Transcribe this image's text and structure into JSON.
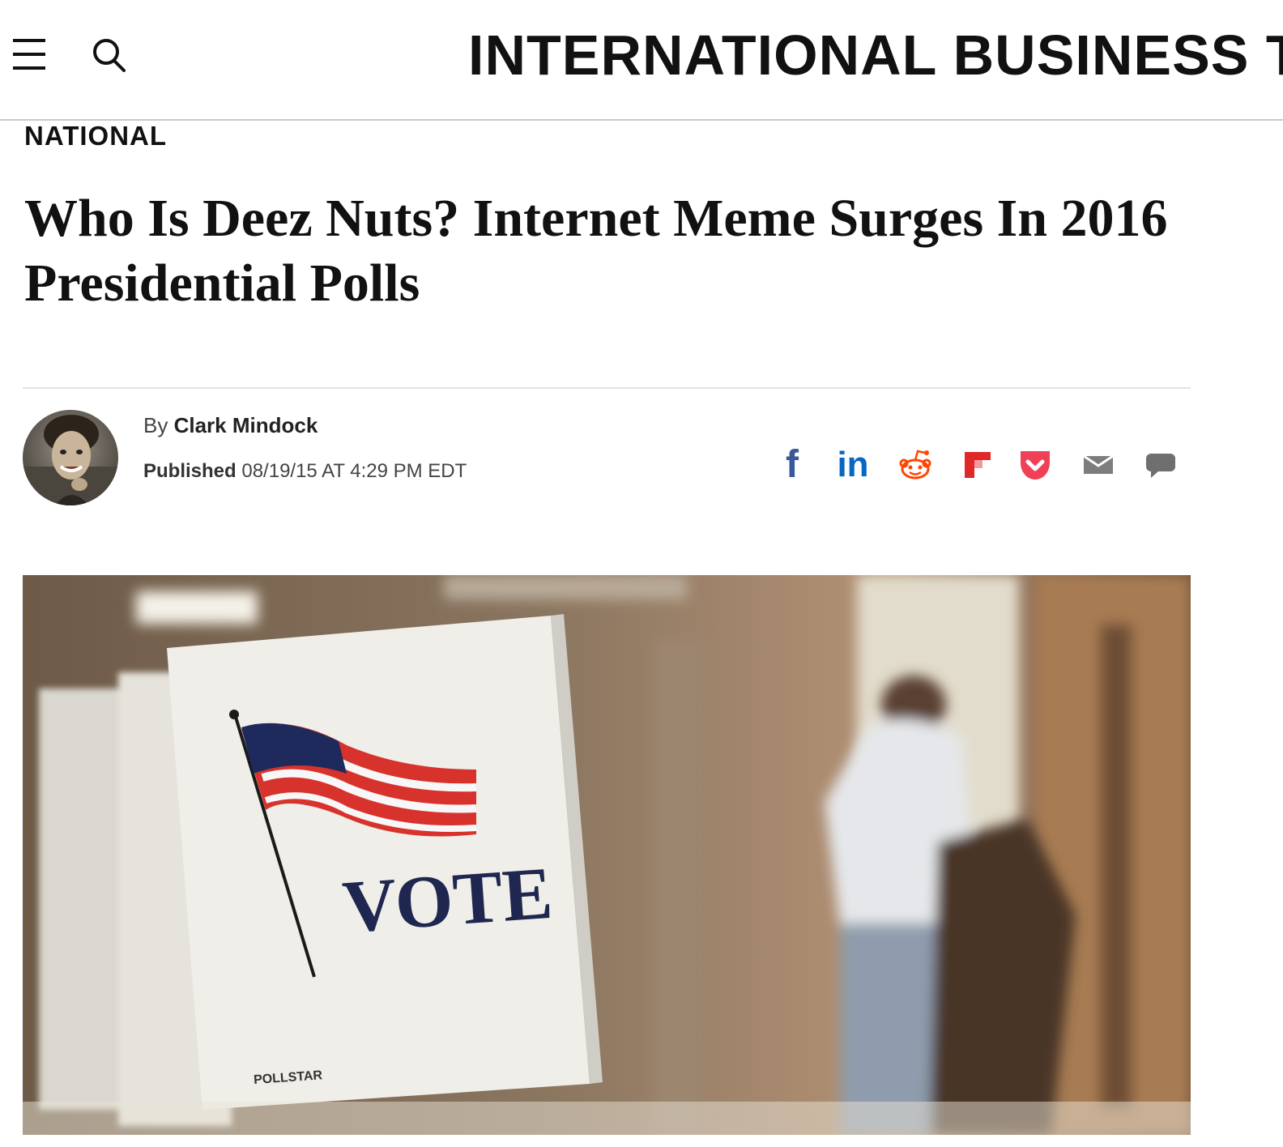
{
  "header": {
    "site_title": "INTERNATIONAL BUSINESS TIMES",
    "menu_icon": "hamburger-menu-icon",
    "search_icon": "search-icon"
  },
  "article": {
    "section": "NATIONAL",
    "headline": "Who Is Deez Nuts? Internet Meme Surges In 2016 Presidential Polls",
    "by_prefix": "By",
    "author": "Clark Mindock",
    "published_label": "Published",
    "published_value": "08/19/15 AT 4:29 PM EDT"
  },
  "share": {
    "icons": [
      "facebook-icon",
      "linkedin-icon",
      "reddit-icon",
      "flipboard-icon",
      "pocket-icon",
      "email-icon",
      "comment-icon"
    ],
    "facebook_glyph": "f",
    "linkedin_glyph": "in"
  },
  "hero_image": {
    "sign_text": "VOTE",
    "brand_text": "POLLSTAR"
  },
  "colors": {
    "facebook": "#3b5998",
    "linkedin": "#0a66c2",
    "reddit": "#ff4500",
    "flipboard": "#e12828",
    "pocket": "#ef4056",
    "email": "#7d7d7d",
    "comment": "#6f6f6f"
  }
}
